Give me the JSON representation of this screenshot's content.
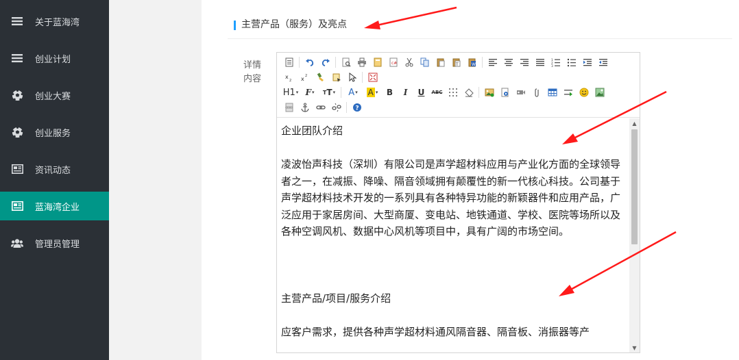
{
  "sidebar": {
    "items": [
      {
        "label": "关于蓝海湾",
        "icon": "menu-lines-icon",
        "active": false
      },
      {
        "label": "创业计划",
        "icon": "menu-lines-icon",
        "active": false
      },
      {
        "label": "创业大赛",
        "icon": "soccer-ball-icon",
        "active": false
      },
      {
        "label": "创业服务",
        "icon": "soccer-ball-icon",
        "active": false
      },
      {
        "label": "资讯动态",
        "icon": "newspaper-icon",
        "active": false
      },
      {
        "label": "蓝海湾企业",
        "icon": "newspaper-icon",
        "active": true
      },
      {
        "label": "管理员管理",
        "icon": "users-icon",
        "active": false
      }
    ]
  },
  "section": {
    "title": "主营产品（服务）及亮点"
  },
  "field": {
    "label_line1": "详情",
    "label_line2": "内容"
  },
  "toolbar": {
    "heading_label": "H1",
    "font_label": "F",
    "size_label": "T",
    "bold_label": "B",
    "italic_label": "I",
    "underline_label": "U",
    "strike_label": "ABC"
  },
  "editor": {
    "paragraphs": {
      "p1": "企业团队介绍",
      "p2": "凌波怡声科技（深圳）有限公司是声学超材料应用与产业化方面的全球领导者之一，在减振、降噪、隔音领域拥有颠覆性的新一代核心科技。公司基于声学超材料技术开发的一系列具有各种特异功能的新颖器件和应用产品，广泛应用于家居房间、大型商厦、变电站、地铁通道、学校、医院等场所以及各种空调风机、数据中心风机等项目中，具有广阔的市场空间。",
      "p3": "主营产品/项目/服务介绍",
      "p4": "应客户需求，提供各种声学超材料通风隔音器、隔音板、消振器等产"
    }
  },
  "colors": {
    "sidebar_bg": "#2b3036",
    "active_bg": "#009688",
    "accent_bar": "#1e9fff",
    "annotation_arrow": "#ff1a1a"
  }
}
